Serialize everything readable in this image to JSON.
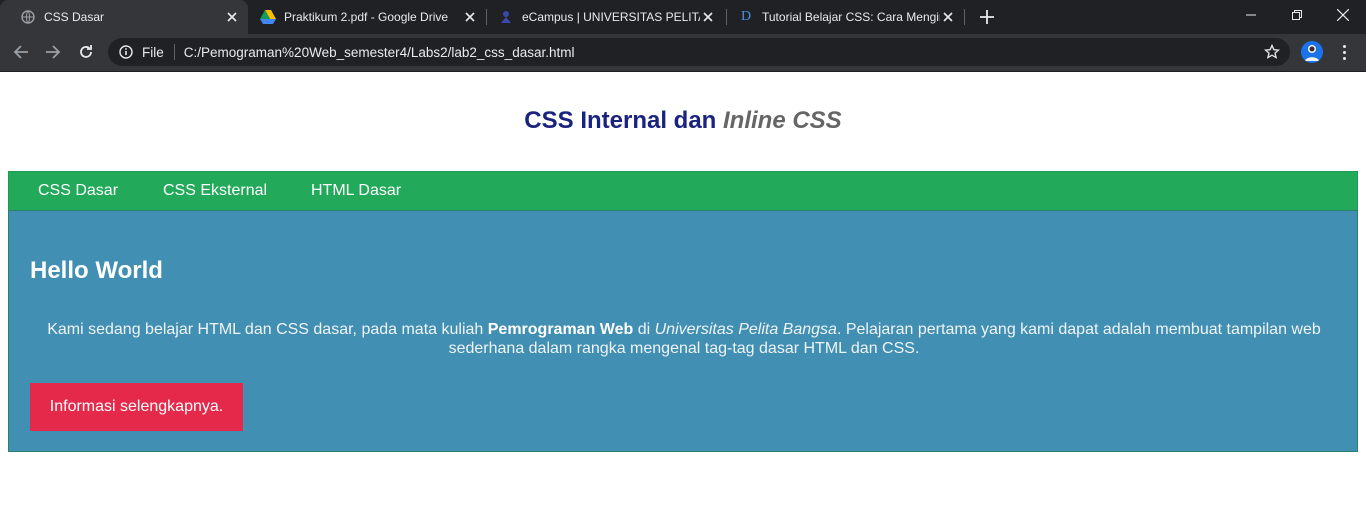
{
  "browser": {
    "tabs": [
      {
        "title": "CSS Dasar",
        "active": true,
        "icon": "globe-icon"
      },
      {
        "title": "Praktikum 2.pdf - Google Drive",
        "active": false,
        "icon": "google-drive-icon"
      },
      {
        "title": "eCampus | UNIVERSITAS PELITA BANGSA",
        "active": false,
        "icon": "ecampus-icon"
      },
      {
        "title": "Tutorial Belajar CSS: Cara Menginput CSS",
        "active": false,
        "icon": "d-letter-icon"
      }
    ],
    "address": {
      "scheme_label": "File",
      "url": "C:/Pemograman%20Web_semester4/Labs2/lab2_css_dasar.html"
    }
  },
  "page": {
    "header": {
      "title_part1": "CSS Internal dan ",
      "title_part2": "Inline CSS"
    },
    "nav": {
      "items": [
        "CSS Dasar",
        "CSS Eksternal",
        "HTML Dasar"
      ]
    },
    "content": {
      "heading": "Hello World",
      "para": {
        "t1": "Kami sedang belajar HTML dan CSS dasar, pada mata kuliah ",
        "bold": "Pemrograman Web",
        "t2": " di ",
        "italic": "Universitas Pelita Bangsa",
        "t3": ". Pelajaran pertama yang kami dapat adalah membuat tampilan web sederhana dalam rangka mengenal tag-tag dasar HTML dan CSS."
      },
      "button_label": "Informasi selengkapnya."
    }
  },
  "colors": {
    "nav_bg": "#22a95a",
    "main_bg": "#418fb2",
    "button_bg": "#e5294a",
    "title_color": "#1a237e"
  }
}
